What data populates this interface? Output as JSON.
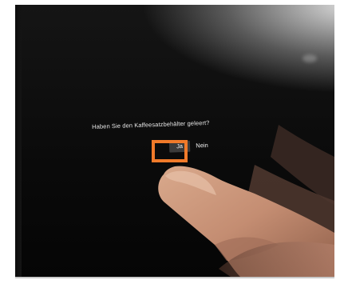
{
  "dialog": {
    "prompt": "Haben Sie den Kaffeesatzbehälter geleert?",
    "yes_label": "Ja",
    "no_label": "Nein"
  },
  "highlight": {
    "color": "#f07a2a",
    "target": "Ja"
  }
}
